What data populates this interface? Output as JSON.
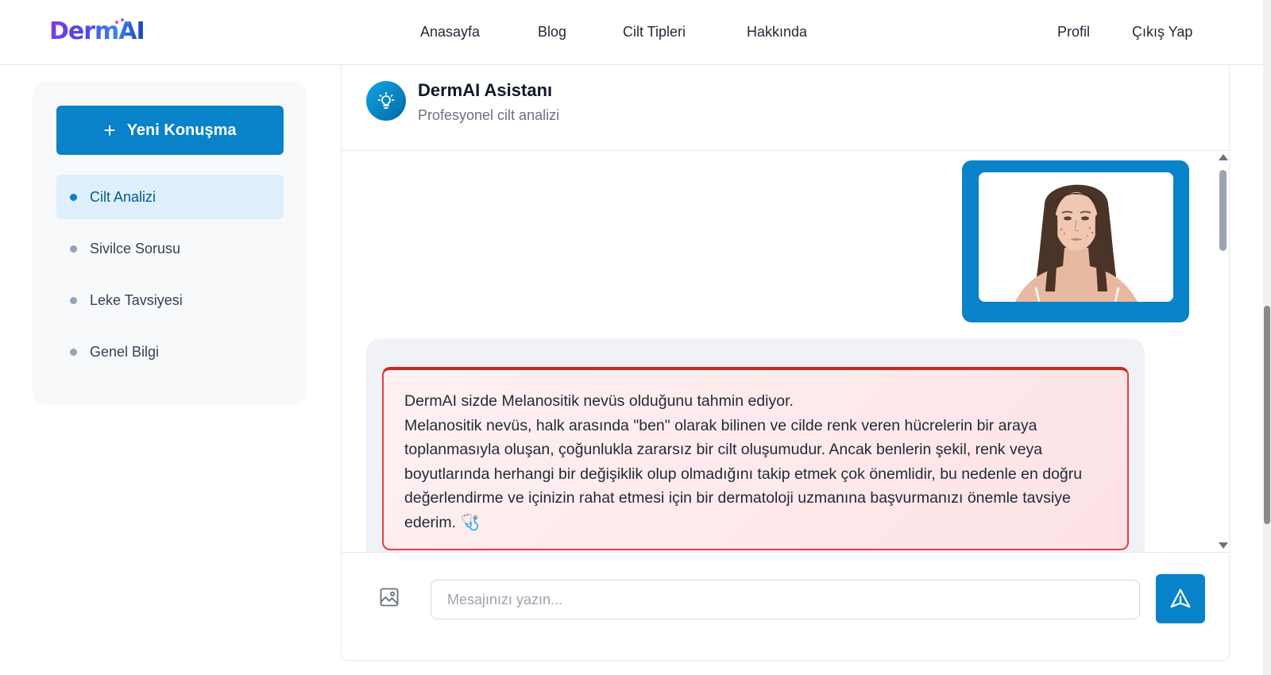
{
  "brand": {
    "logo_text": "DermAI"
  },
  "nav": {
    "links": [
      "Anasayfa",
      "Blog",
      "Cilt Tipleri",
      "Hakkında"
    ],
    "profile": "Profil",
    "logout": "Çıkış Yap"
  },
  "sidebar": {
    "new_chat_label": "Yeni Konuşma",
    "items": [
      {
        "label": "Cilt Analizi",
        "active": true
      },
      {
        "label": "Sivilce Sorusu",
        "active": false
      },
      {
        "label": "Leke Tavsiyesi",
        "active": false
      },
      {
        "label": "Genel Bilgi",
        "active": false
      }
    ]
  },
  "chat": {
    "assistant_name": "DermAI Asistanı",
    "assistant_subtitle": "Profesyonel cilt analizi",
    "bot_message": {
      "headline": "DermAI sizde Melanositik nevüs olduğunu tahmin ediyor.",
      "body": "Melanositik nevüs, halk arasında \"ben\" olarak bilinen ve cilde renk veren hücrelerin bir araya toplanmasıyla oluşan, çoğunlukla zararsız bir cilt oluşumudur. Ancak benlerin şekil, renk veya boyutlarında herhangi bir değişiklik olup olmadığını takip etmek çok önemlidir, bu nedenle en doğru değerlendirme ve içinizin rahat etmesi için bir dermatoloji uzmanına başvurmanızı önemle tavsiye ederim.",
      "emoji": "🩺"
    },
    "input_placeholder": "Mesajınızı yazın...",
    "input_value": ""
  },
  "colors": {
    "primary": "#0882c9",
    "active_bg": "#ddf0fb",
    "alert_border": "#e23d45",
    "alert_bg": "#fde2e5"
  },
  "icons": {
    "assistant": "lightbulb-icon",
    "upload": "image-icon",
    "send": "send-icon",
    "new_chat": "plus-icon"
  }
}
